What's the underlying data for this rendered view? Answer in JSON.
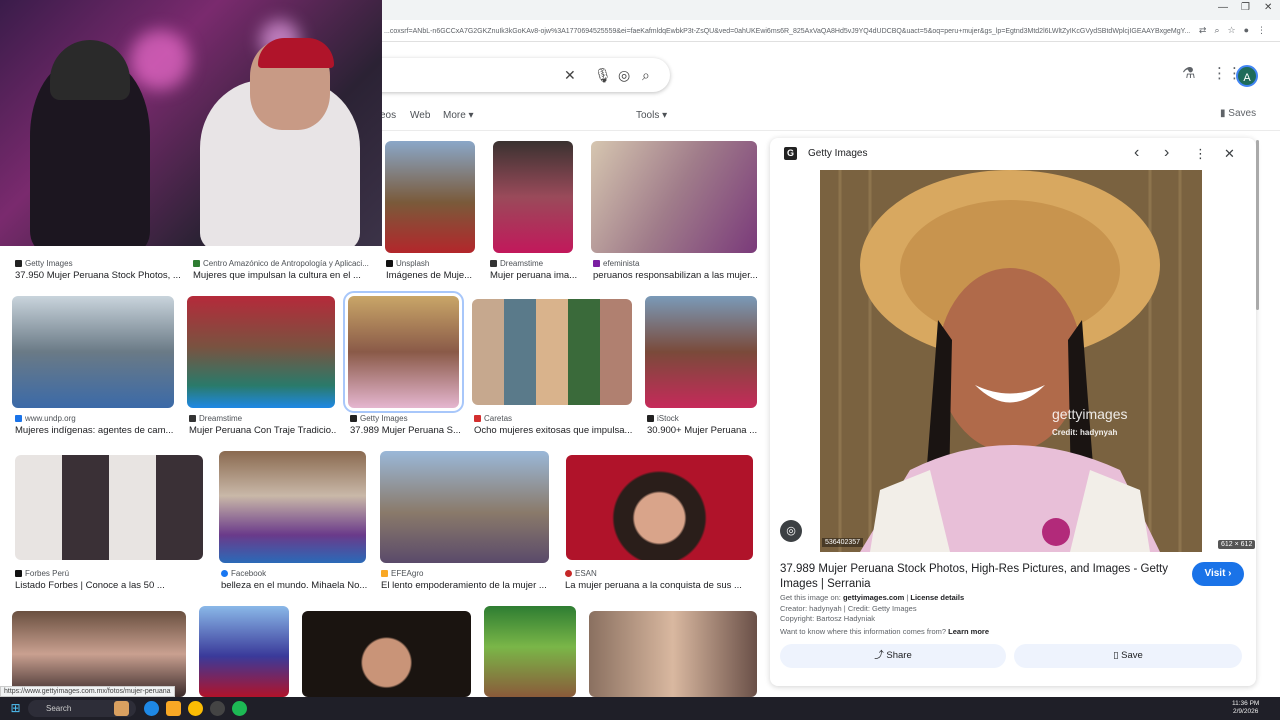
{
  "browser": {
    "url": "...coxsrf=ANbL-n6GCCxA7G2GKZnuIk3kGoKAv8-ojw%3A1770694525559&ei=faeKafmldqEwbkP3t-ZsQU&ved=0ahUKEwi6ms6R_825AxVaQA8Hd5vJ9YQ4dUDCBQ&uact=5&oq=peru+mujer&gs_lp=Egtnd3Mtd2l6LWltZyIKcGVydSBtdWplcjIGEAAYBxgeMgY...",
    "window_controls": [
      "—",
      "❐",
      "✕"
    ],
    "status_url": "https://www.gettyimages.com.mx/fotos/mujer-peruana"
  },
  "header": {
    "avatar_letter": "A",
    "tabs": [
      "eos",
      "Web",
      "More ▾",
      "Tools ▾"
    ],
    "saves_label": "Saves"
  },
  "results": [
    {
      "source": "Getty Images",
      "title": "37.950 Mujer Peruana Stock Photos, ...",
      "color": "#222222"
    },
    {
      "source": "Centro Amazónico de Antropología y Aplicaci...",
      "title": "Mujeres que impulsan la cultura en el ...",
      "color": "#2e7d32"
    },
    {
      "source": "Unsplash",
      "title": "Imágenes de Muje...",
      "color": "#111111"
    },
    {
      "source": "Dreamstime",
      "title": "Mujer peruana ima...",
      "color": "#333333"
    },
    {
      "source": "efeminista",
      "title": "peruanos responsabilizan a las mujer...",
      "color": "#7b1fa2"
    },
    {
      "source": "www.undp.org",
      "title": "Mujeres indígenas: agentes de cam...",
      "color": "#1a73e8"
    },
    {
      "source": "Dreamstime",
      "title": "Mujer Peruana Con Traje Tradicio...",
      "color": "#333333"
    },
    {
      "source": "Getty Images",
      "title": "37.989 Mujer Peruana S...",
      "color": "#222222"
    },
    {
      "source": "Caretas",
      "title": "Ocho mujeres exitosas que impulsa...",
      "color": "#d32f2f"
    },
    {
      "source": "iStock",
      "title": "30.900+ Mujer Peruana ...",
      "color": "#222222"
    },
    {
      "source": "Forbes Perú",
      "title": "Listado Forbes | Conoce a las 50 ...",
      "color": "#111111"
    },
    {
      "source": "Facebook",
      "title": "belleza en el mundo. Mihaela No...",
      "color": "#1877f2"
    },
    {
      "source": "EFEAgro",
      "title": "El lento empoderamiento de la mujer ...",
      "color": "#f9a825"
    },
    {
      "source": "ESAN",
      "title": "La mujer peruana a la conquista de sus ...",
      "color": "#c62828"
    }
  ],
  "panel": {
    "source": "Getty Images",
    "logo_letter": "G",
    "watermark": "gettyimages",
    "watermark_credit": "Credit: hadynyah",
    "image_id": "536402357",
    "dimensions": "612 × 612",
    "title": "37.989 Mujer Peruana Stock Photos, High-Res Pictures, and Images - Getty Images | Serrania",
    "visit_label": "Visit ›",
    "get_image_prefix": "Get this image on:",
    "get_image_site": "gettyimages.com",
    "license_label": "License details",
    "creator_line": "Creator: hadynyah | Credit: Getty Images",
    "copyright_line": "Copyright: Bartosz Hadyniak",
    "know_prefix": "Want to know where this information comes from?",
    "learn_more": "Learn more",
    "share_label": "Share",
    "save_label": "Save"
  },
  "taskbar": {
    "search_label": "Search",
    "time": "11:36 PM",
    "date": "2/9/2026"
  },
  "icons": [
    "close-icon",
    "mic-icon",
    "lens-icon",
    "search-icon",
    "labs-icon",
    "apps-icon",
    "back-icon",
    "forward-icon",
    "more-icon",
    "share-icon",
    "bookmark-icon",
    "windows-icon"
  ]
}
